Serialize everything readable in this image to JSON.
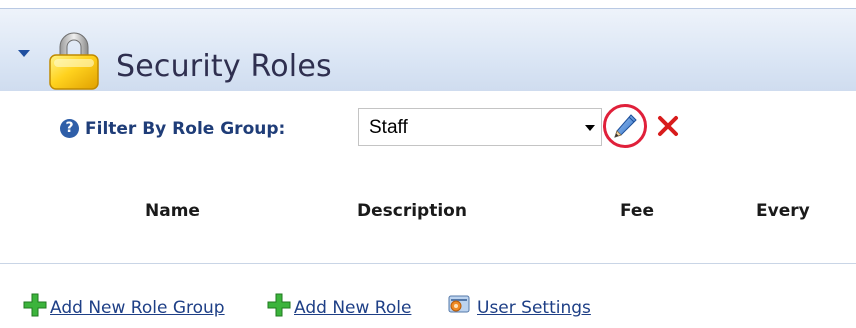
{
  "module": {
    "title": "Security Roles",
    "icon": "lock-icon",
    "collapse_icon": "collapse-triangle-icon"
  },
  "filter": {
    "help_icon": "help-icon",
    "help_glyph": "?",
    "label": "Filter By Role Group:",
    "selected_value": "Staff",
    "edit_icon": "edit-pencil-icon",
    "delete_icon": "delete-x-icon",
    "highlight_color": "#e0203a"
  },
  "table": {
    "columns": [
      "Name",
      "Description",
      "Fee",
      "Every"
    ]
  },
  "footer": {
    "links": [
      {
        "label": "Add New Role Group",
        "icon": "add-plus-icon"
      },
      {
        "label": "Add New Role",
        "icon": "add-plus-icon"
      },
      {
        "label": "User Settings",
        "icon": "user-settings-icon"
      }
    ]
  },
  "colors": {
    "header_background": "#dbe6f5",
    "label_blue": "#1f3d78",
    "link_blue": "#1e3f86",
    "accent_red": "#e0203a",
    "add_green": "#3cb43c"
  }
}
